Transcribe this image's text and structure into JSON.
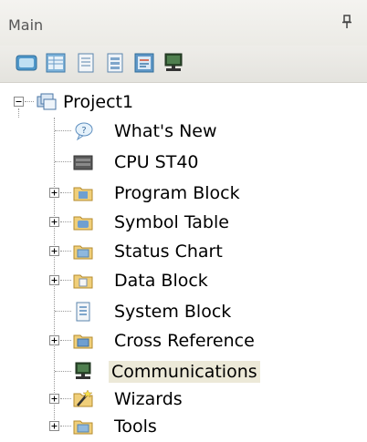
{
  "panel": {
    "title": "Main"
  },
  "toolbar": {
    "icons": [
      "symbol-table-icon",
      "status-chart-icon",
      "data-block-icon",
      "system-block-icon",
      "cross-reference-icon",
      "communications-icon"
    ]
  },
  "tree": {
    "root": {
      "label": "Project1",
      "expanded": true
    },
    "items": [
      {
        "label": "What's New",
        "icon": "whats-new-icon",
        "expandable": false
      },
      {
        "label": "CPU ST40",
        "icon": "cpu-icon",
        "expandable": false
      },
      {
        "label": "Program Block",
        "icon": "program-block-icon",
        "expandable": true
      },
      {
        "label": "Symbol Table",
        "icon": "symbol-table-icon",
        "expandable": true
      },
      {
        "label": "Status Chart",
        "icon": "status-chart-icon",
        "expandable": true
      },
      {
        "label": "Data Block",
        "icon": "data-block-icon",
        "expandable": true
      },
      {
        "label": "System Block",
        "icon": "system-block-icon",
        "expandable": false
      },
      {
        "label": "Cross Reference",
        "icon": "cross-reference-icon",
        "expandable": true
      },
      {
        "label": "Communications",
        "icon": "communications-icon",
        "expandable": false,
        "selected": true
      },
      {
        "label": "Wizards",
        "icon": "wizards-icon",
        "expandable": true
      },
      {
        "label": "Tools",
        "icon": "tools-icon",
        "expandable": true
      }
    ]
  }
}
